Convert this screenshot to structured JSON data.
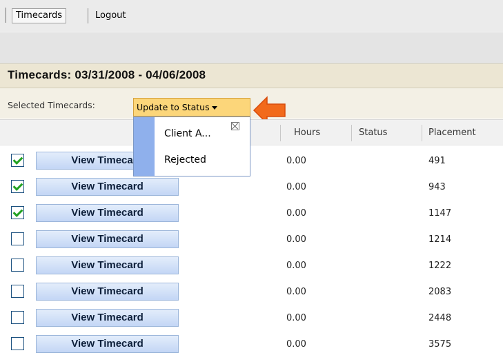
{
  "nav": {
    "timecards_tab": "Timecards",
    "logout_link": "Logout"
  },
  "page": {
    "title": "Timecards: 03/31/2008 - 04/06/2008",
    "selected_label": "Selected Timecards:",
    "status_button": "Update to Status"
  },
  "dropdown": {
    "items": [
      "Client A...",
      "Rejected"
    ]
  },
  "table": {
    "columns": [
      "Hours",
      "Status",
      "Placement"
    ],
    "button_label": "View Timecard",
    "rows": [
      {
        "checked": true,
        "hours": "0.00",
        "status": "",
        "placement": "491"
      },
      {
        "checked": true,
        "hours": "0.00",
        "status": "",
        "placement": "943"
      },
      {
        "checked": true,
        "hours": "0.00",
        "status": "",
        "placement": "1147"
      },
      {
        "checked": false,
        "hours": "0.00",
        "status": "",
        "placement": "1214"
      },
      {
        "checked": false,
        "hours": "0.00",
        "status": "",
        "placement": "1222"
      },
      {
        "checked": false,
        "hours": "0.00",
        "status": "",
        "placement": "2083"
      },
      {
        "checked": false,
        "hours": "0.00",
        "status": "",
        "placement": "2448"
      },
      {
        "checked": false,
        "hours": "0.00",
        "status": "",
        "placement": "3575"
      }
    ]
  },
  "icons": {
    "caret": "dropdown-caret-icon",
    "close": "close-icon",
    "arrow": "arrow-left-icon"
  },
  "colors": {
    "status_button": "#fcd67a",
    "arrow": "#f26a1b",
    "title_bar": "#ece6d3"
  }
}
